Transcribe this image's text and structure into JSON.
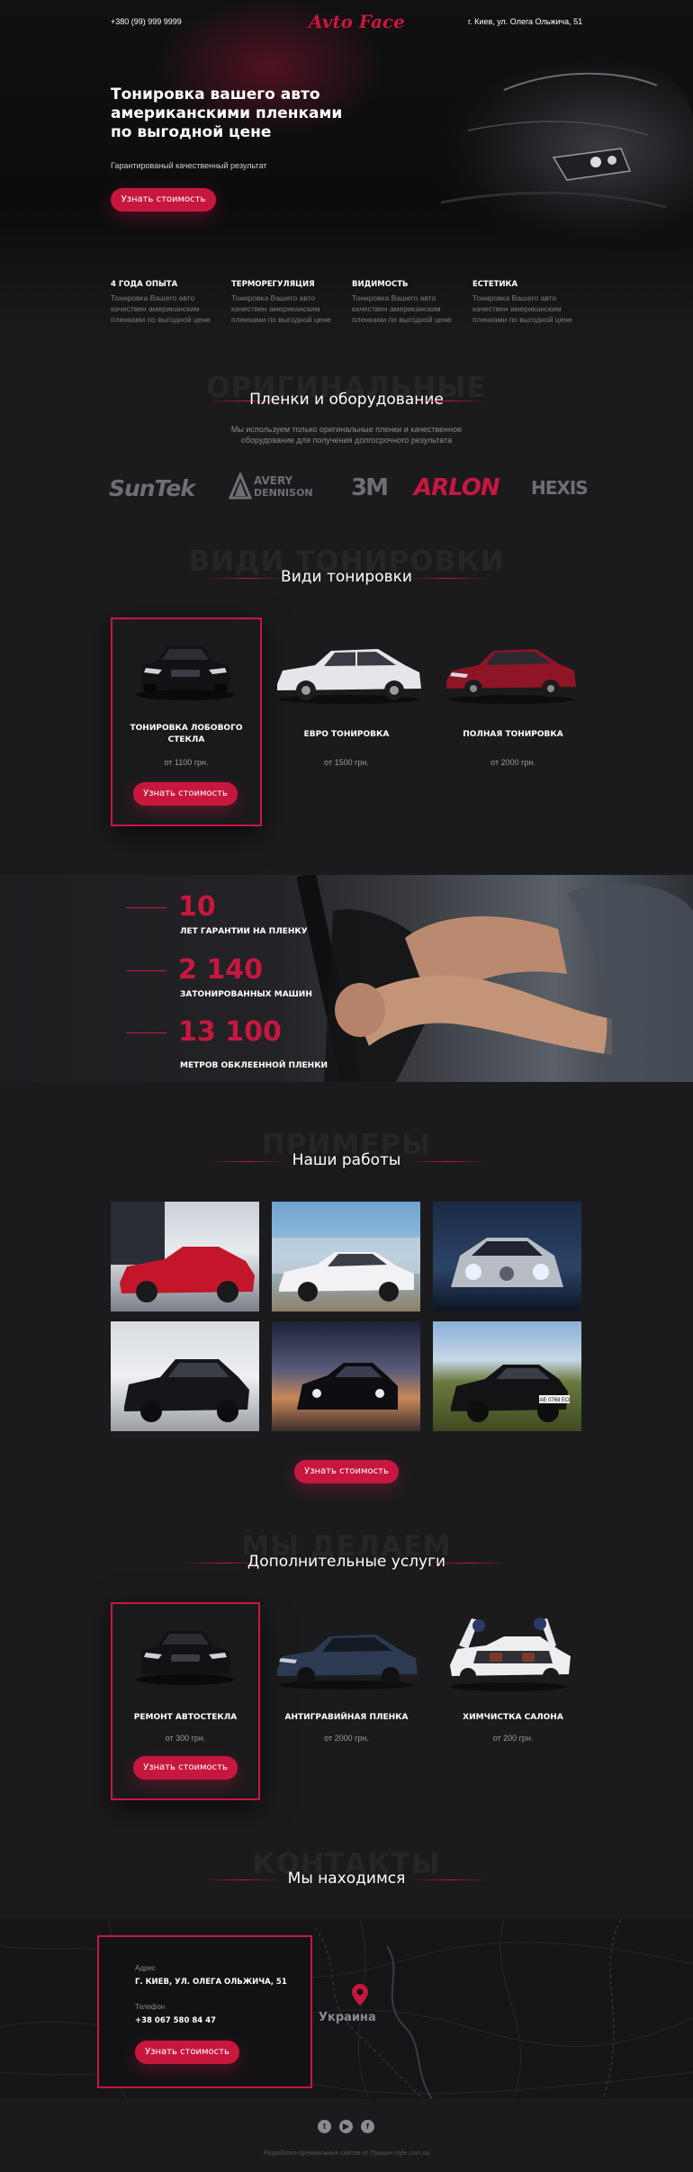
{
  "header": {
    "phone": "+380 (99) 999 9999",
    "logo": "Avto Face",
    "address": "г. Киев, ул. Олега Ольжича, 51"
  },
  "hero": {
    "title_line1": "Тонировка вашего авто",
    "title_line2": "американскими пленками",
    "title_line3": "по выгодной цене",
    "subtitle": "Гарантированый качественный результат",
    "button": "Узнать стоимость"
  },
  "features": [
    {
      "title": "4 ГОДА ОПЫТА",
      "text": "Тонировка Вашего авто качествен американским пленками по выгодной цене"
    },
    {
      "title": "ТЕРМОРЕГУЛЯЦИЯ",
      "text": "Тонировка Вашего авто качествен американским пленками по выгодной цене"
    },
    {
      "title": "ВИДИМОСТЬ",
      "text": "Тонировка Вашего авто качествен американским пленками по выгодной цене"
    },
    {
      "title": "ЕСТЕТИКА",
      "text": "Тонировка Вашего авто качествен американским пленками по выгодной цене"
    }
  ],
  "films": {
    "ghost": "ОРИГИНАЛЬНЫЕ",
    "title": "Пленки и оборудование",
    "text_line1": "Мы используем только оригинальные пленки и качественное",
    "text_line2": "оборудование для получения долгосрочного результата",
    "brands": [
      "SunTek",
      "AVERY",
      "DENNISON",
      "3M",
      "ARLON",
      "HEXIS"
    ]
  },
  "tint": {
    "ghost": "ВИДИ ТОНИРОВКИ",
    "title": "Види тонировки",
    "cards": [
      {
        "name_line1": "ТОНИРОВКА ЛОБОВОГО",
        "name_line2": "СТЕКЛА",
        "price": "от 1100 грн.",
        "button": "Узнать стоимость"
      },
      {
        "name_line1": "ЕВРО ТОНИРОВКА",
        "name_line2": "",
        "price": "от 1500 грн."
      },
      {
        "name_line1": "ПОЛНАЯ ТОНИРОВКА",
        "name_line2": "",
        "price": "от 2000 грн."
      }
    ]
  },
  "stats": [
    {
      "number": "10",
      "label": "ЛЕТ ГАРАНТИИ НА ПЛЕНКУ"
    },
    {
      "number": "2 140",
      "label": "ЗАТОНИРОВАННЫХ МАШИН"
    },
    {
      "number": "13 100",
      "label": "МЕТРОВ ОБКЛЕЕННОЙ ПЛЕНКИ"
    }
  ],
  "works": {
    "ghost": "ПРИМЕРЫ",
    "title": "Наши работы",
    "button": "Узнать стоимость",
    "plate": "AE 0769 EO"
  },
  "extra": {
    "ghost": "МЫ ДЕЛАЕМ",
    "title": "Дополнительные услуги",
    "cards": [
      {
        "name": "РЕМОНТ АВТОСТЕКЛА",
        "price": "от 300 грн.",
        "button": "Узнать стоимость"
      },
      {
        "name": "АНТИГРАВИЙНАЯ ПЛЕНКА",
        "price": "от 2000 грн."
      },
      {
        "name": "ХИМЧИСТКА САЛОНА",
        "price": "от 200 грн."
      }
    ]
  },
  "contacts": {
    "ghost": "КОНТАКТЫ",
    "title": "Мы находимся",
    "address_label": "Адрес",
    "address": "Г. КИЕВ, УЛ. ОЛЕГА ОЛЬЖИЧА, 51",
    "phone_label": "Телефон",
    "phone": "+38 067 580 84 47",
    "button": "Узнать стоимость",
    "map_label": "Украина"
  },
  "footer": {
    "text": "Разработка премиальных сайтов от Пушкин style.com.ua"
  },
  "colors": {
    "accent": "#c8173f",
    "background": "#1b1b1d"
  }
}
